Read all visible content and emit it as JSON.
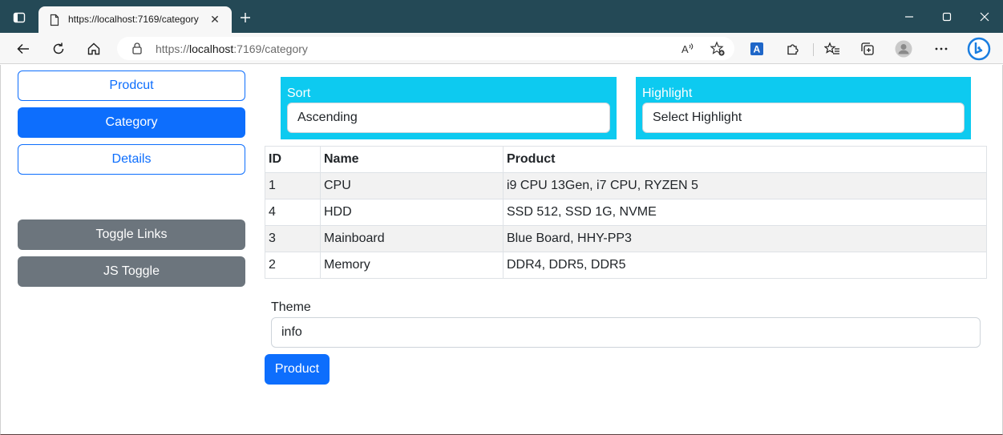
{
  "browser": {
    "tab_title": "https://localhost:7169/category",
    "url_prefix": "https://",
    "url_host": "localhost",
    "url_rest": ":7169/category",
    "accent_color": "#244956"
  },
  "sidebar": {
    "links": [
      {
        "label": "Prodcut",
        "style": "outline"
      },
      {
        "label": "Category",
        "style": "primary"
      },
      {
        "label": "Details",
        "style": "outline"
      }
    ],
    "toggles": [
      {
        "label": "Toggle Links"
      },
      {
        "label": "JS Toggle"
      }
    ]
  },
  "sort": {
    "label": "Sort",
    "selected": "Ascending"
  },
  "highlight": {
    "label": "Highlight",
    "selected": "Select Highlight"
  },
  "table": {
    "headers": [
      "ID",
      "Name",
      "Product"
    ],
    "rows": [
      [
        "1",
        "CPU",
        "i9 CPU 13Gen, i7 CPU, RYZEN 5"
      ],
      [
        "4",
        "HDD",
        "SSD 512, SSD 1G, NVME"
      ],
      [
        "3",
        "Mainboard",
        "Blue Board, HHY-PP3"
      ],
      [
        "2",
        "Memory",
        "DDR4, DDR5, DDR5"
      ]
    ]
  },
  "theme": {
    "label": "Theme",
    "value": "info"
  },
  "product_button": {
    "label": "Product"
  },
  "colors": {
    "primary": "#0d6efd",
    "info": "#0dcaf0",
    "secondary": "#6c757d"
  }
}
